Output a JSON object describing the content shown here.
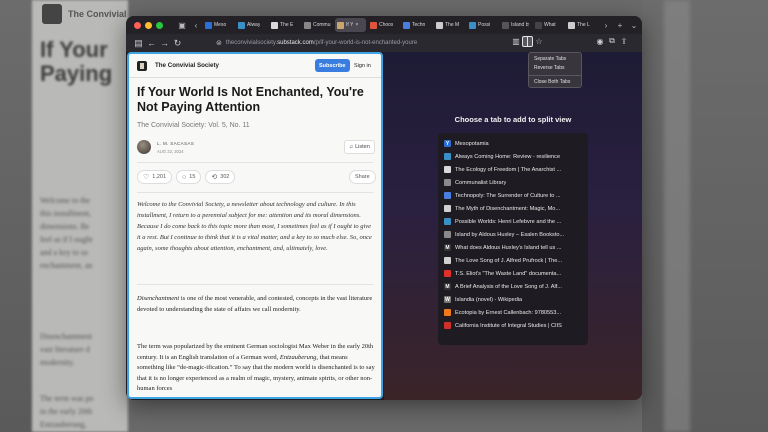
{
  "backdrop": {
    "title": "If Your Paying",
    "logo_text": "The Convivial",
    "lines": [
      "Welcome to the",
      "this installment,",
      "dimensions. Be",
      "feel as if I ought",
      "and a key to so",
      "enchantment, an",
      "Disenchantment",
      "vast literature d",
      "modernity.",
      "The term was po",
      "in the early 20th",
      "Entzauberung,"
    ]
  },
  "tabs": [
    {
      "label": "Meso",
      "color": "#2b6fd6",
      "active": false
    },
    {
      "label": "Alway",
      "color": "#3a8fc7",
      "active": false
    },
    {
      "label": "The E",
      "color": "#d9d9d9",
      "active": false
    },
    {
      "label": "Commu",
      "color": "#888888",
      "active": false
    },
    {
      "label": "If Y",
      "color": "#c9a66b",
      "active": true
    },
    {
      "label": "Choos",
      "color": "#e0543c",
      "active": false
    },
    {
      "label": "Techn",
      "color": "#4a7de0",
      "active": false
    },
    {
      "label": "The M",
      "color": "#cccccc",
      "active": false
    },
    {
      "label": "Possi",
      "color": "#3a8fc7",
      "active": false
    },
    {
      "label": "Island by",
      "color": "#555555",
      "active": false
    },
    {
      "label": "What",
      "color": "#444444",
      "active": false
    },
    {
      "label": "The L",
      "color": "#cccccc",
      "active": false
    }
  ],
  "url": {
    "domain_prefix": "theconvivialsociety.",
    "domain": "substack.com",
    "path": "/p/if-your-world-is-not-enchanted-youre"
  },
  "dropdown": {
    "items": [
      "Separate Tabs",
      "Reverse Tabs",
      "Close Both Tabs"
    ]
  },
  "article": {
    "publication": "The Convivial Society",
    "subscribe": "Subscribe",
    "sign_in": "Sign in",
    "title": "If Your World Is Not Enchanted, You're Not Paying Attention",
    "subtitle": "The Convivial Society: Vol. 5, No. 11",
    "author": "L. M. SACASAS",
    "date": "AUG 22, 2024",
    "listen": "Listen",
    "likes": "1,201",
    "comments": "15",
    "restacks": "302",
    "share": "Share",
    "intro": "Welcome to the Convivial Society, a newsletter about technology and culture. In this installment, I return to a perennial subject for me: attention and its moral dimensions. Because I do come back to this topic more than most, I sometimes feel as if I ought to give it a rest. But I continue to think that it is a vital matter, and a key to so much else. So, once again, some thoughts about attention, enchantment, and, ultimately, love.",
    "p1_em": "Disenchantment",
    "p1_rest": " is one of the most venerable, and contested, concepts in the vast literature devoted to understanding the state of affairs we call modernity.",
    "p2_a": "The term was popularized by the eminent German sociologist Max Weber in the early 20th century. It is an English translation of a German word, ",
    "p2_em": "Entzauberung",
    "p2_b": ", that means something like “de-magic-ification.” To say that the modern world is disenchanted is to say that it is no longer experienced as a realm of magic, mystery, animate spirits, or other non-human forces"
  },
  "split_view": {
    "prompt": "Choose a tab to add to split view",
    "tabs": [
      {
        "label": "Mesopotamia",
        "icon": "wikipedia-icon",
        "glyph": "Y",
        "color": "#2b6fd6"
      },
      {
        "label": "Always Coming Home: Review - resilience",
        "icon": "resilience-icon",
        "glyph": "",
        "color": "#3a8fc7"
      },
      {
        "label": "The Ecology of Freedom | The Anarchist ...",
        "icon": "page-icon",
        "glyph": "",
        "color": "#d9d9d9"
      },
      {
        "label": "Communalist Library",
        "icon": "globe-icon",
        "glyph": "",
        "color": "#8a8a8a"
      },
      {
        "label": "Technopoly: The Surrender of Culture to ...",
        "icon": "technopoly-icon",
        "glyph": "",
        "color": "#4a7de0"
      },
      {
        "label": "The Myth of Disenchantment: Magic, Mo...",
        "icon": "page-icon",
        "glyph": "",
        "color": "#d0d0d0"
      },
      {
        "label": "Possible Worlds: Henri Lefebvre and the ...",
        "icon": "possible-worlds-icon",
        "glyph": "",
        "color": "#3a8fc7"
      },
      {
        "label": "Island by Aldous Huxley – Esalen Booksto...",
        "icon": "globe-icon",
        "glyph": "",
        "color": "#8a8a8a"
      },
      {
        "label": "What does Aldous Huxley's Island tell us ...",
        "icon": "medium-icon",
        "glyph": "M",
        "color": "#333333"
      },
      {
        "label": "The Love Song of J. Alfred Prufrock | The...",
        "icon": "page-icon",
        "glyph": "",
        "color": "#d0d0d0"
      },
      {
        "label": "T.S. Eliot's \"The Waste Land\" documenta...",
        "icon": "youtube-icon",
        "glyph": "",
        "color": "#e0302a"
      },
      {
        "label": "A Brief Analysis of the Love Song of J. Alf...",
        "icon": "medium-icon",
        "glyph": "M",
        "color": "#333333"
      },
      {
        "label": "Islandia (novel) - Wikipedia",
        "icon": "wikipedia-icon",
        "glyph": "W",
        "color": "#777777"
      },
      {
        "label": "Ecotopia by Ernest Callenbach: 9780553...",
        "icon": "penguin-icon",
        "glyph": "",
        "color": "#f07a1a"
      },
      {
        "label": "California Institute of Integral Studies | CIIS",
        "icon": "ciis-icon",
        "glyph": "",
        "color": "#d0302a"
      }
    ]
  },
  "colors": {
    "accent": "#3fa4e4",
    "subscribe": "#3a7de0",
    "traffic_red": "#ff5f57",
    "traffic_yellow": "#febc2e",
    "traffic_green": "#28c840"
  }
}
